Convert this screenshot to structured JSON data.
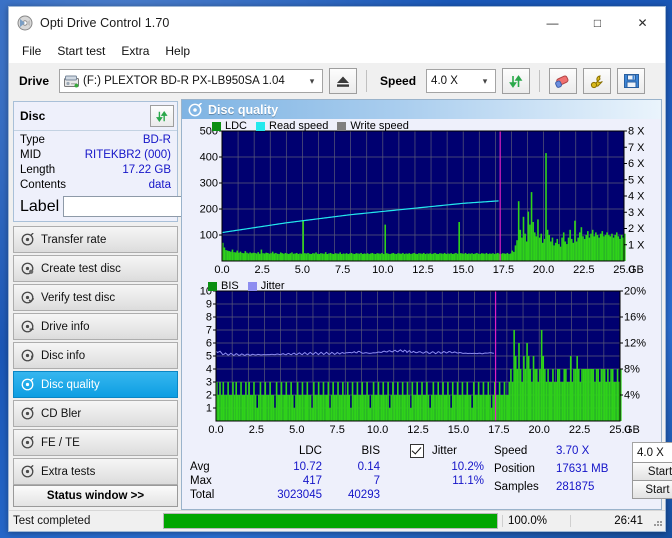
{
  "window": {
    "title": "Opti Drive Control 1.70",
    "icon": "disc-icon",
    "minimize": "—",
    "maximize": "□",
    "close": "✕"
  },
  "menu": [
    "File",
    "Start test",
    "Extra",
    "Help"
  ],
  "toolbar": {
    "drive_label": "Drive",
    "drive_value": "(F:)   PLEXTOR BD-R  PX-LB950SA 1.04",
    "eject_icon": "eject-icon",
    "speed_label": "Speed",
    "speed_value": "4.0 X",
    "refresh_icon": "refresh-icon",
    "erase_icon": "eraser-icon",
    "tools_icon": "wrench-icon",
    "save_icon": "floppy-save-icon"
  },
  "disc": {
    "header": "Disc",
    "refresh_icon": "refresh-icon",
    "rows": [
      {
        "key": "Type",
        "value": "BD-R"
      },
      {
        "key": "MID",
        "value": "RITEKBR2 (000)"
      },
      {
        "key": "Length",
        "value": "17.22 GB"
      },
      {
        "key": "Contents",
        "value": "data"
      }
    ],
    "label_key": "Label",
    "label_value": "",
    "label_placeholder": "",
    "disc_icon": "cd-icon"
  },
  "nav": [
    {
      "label": "Transfer rate",
      "icon": "disc-icon",
      "selected": false
    },
    {
      "label": "Create test disc",
      "icon": "disc-icon",
      "selected": false
    },
    {
      "label": "Verify test disc",
      "icon": "disc-icon",
      "selected": false
    },
    {
      "label": "Drive info",
      "icon": "disc-icon",
      "selected": false
    },
    {
      "label": "Disc info",
      "icon": "disc-icon",
      "selected": false
    },
    {
      "label": "Disc quality",
      "icon": "disc-icon",
      "selected": true
    },
    {
      "label": "CD Bler",
      "icon": "disc-icon",
      "selected": false
    },
    {
      "label": "FE / TE",
      "icon": "disc-icon",
      "selected": false
    },
    {
      "label": "Extra tests",
      "icon": "disc-icon",
      "selected": false
    }
  ],
  "status_window_button": "Status window >>",
  "pane": {
    "title": "Disc quality",
    "icon": "disc-quality-icon"
  },
  "stats": {
    "col_ldc": "LDC",
    "col_bis": "BIS",
    "row_avg": "Avg",
    "row_max": "Max",
    "row_total": "Total",
    "ldc_avg": "10.72",
    "ldc_max": "417",
    "ldc_total": "3023045",
    "bis_avg": "0.14",
    "bis_max": "7",
    "bis_total": "40293",
    "jitter_label": "Jitter",
    "jitter_checked": true,
    "jitter_avg": "10.2%",
    "jitter_max": "11.1%",
    "speed_label": "Speed",
    "speed_value": "3.70 X",
    "position_label": "Position",
    "position_value": "17631 MB",
    "samples_label": "Samples",
    "samples_value": "281875",
    "speed_select": "4.0 X",
    "start_full": "Start full",
    "start_part": "Start part"
  },
  "statusbar": {
    "text": "Test completed",
    "progress": 100,
    "percent": "100.0%",
    "time": "26:41"
  },
  "colors": {
    "plot_bg": "#000070",
    "ldc_green": "#2fd21a",
    "read_speed": "#23e9ed",
    "write_speed": "#7f7f7f",
    "jitter": "#8d8df0",
    "marker": "#e020c0",
    "grid": "#5a5a78",
    "value_blue": "#1414c8",
    "accent": "#0d9ee2",
    "progress_green": "#00a600"
  },
  "chart_data": [
    {
      "type": "line",
      "id": "ldc-chart",
      "title": "",
      "legend": [
        {
          "label": "LDC",
          "color": "#2fd21a"
        },
        {
          "label": "Read speed",
          "color": "#23e9ed"
        },
        {
          "label": "Write speed",
          "color": "#7f7f7f"
        }
      ],
      "legend_position": "top-left",
      "xlabel": "GB",
      "xlim": [
        0,
        25
      ],
      "xticks": [
        "0.0",
        "2.5",
        "5.0",
        "7.5",
        "10.0",
        "12.5",
        "15.0",
        "17.5",
        "20.0",
        "22.5",
        "25.0"
      ],
      "ylabel_left": "LDC",
      "ylim_left": [
        0,
        500
      ],
      "yticks_left": [
        "100",
        "200",
        "300",
        "400",
        "500"
      ],
      "ylabel_right": "Speed",
      "ylim_right": [
        0,
        8
      ],
      "yticks_right": [
        "1 X",
        "2 X",
        "3 X",
        "4 X",
        "5 X",
        "6 X",
        "7 X",
        "8 X"
      ],
      "grid": true,
      "marker_x": 17.3,
      "data_end_x": 17.2,
      "series": [
        {
          "name": "LDC",
          "type": "area",
          "color": "#2fd21a",
          "x_step": 0.1,
          "values": [
            70,
            52,
            42,
            40,
            38,
            36,
            44,
            34,
            33,
            40,
            32,
            36,
            31,
            30,
            38,
            32,
            29,
            33,
            30,
            32,
            31,
            29,
            34,
            28,
            44,
            30,
            29,
            32,
            31,
            28,
            30,
            36,
            29,
            31,
            28,
            27,
            33,
            30,
            28,
            31,
            29,
            27,
            30,
            33,
            28,
            29,
            31,
            27,
            29,
            28,
            155,
            30,
            29,
            31,
            28,
            27,
            30,
            29,
            33,
            28,
            27,
            30,
            29,
            28,
            34,
            27,
            29,
            31,
            28,
            27,
            30,
            29,
            28,
            33,
            27,
            29,
            28,
            30,
            27,
            29,
            31,
            28,
            27,
            30,
            29,
            28,
            31,
            27,
            29,
            28,
            30,
            27,
            29,
            31,
            28,
            27,
            30,
            29,
            28,
            31,
            27,
            140,
            30,
            28,
            27,
            29,
            31,
            28,
            27,
            30,
            29,
            28,
            31,
            27,
            29,
            28,
            30,
            27,
            29,
            31,
            28,
            27,
            30,
            29,
            28,
            31,
            27,
            29,
            28,
            30,
            27,
            29,
            31,
            28,
            27,
            30,
            29,
            28,
            31,
            27,
            29,
            28,
            30,
            27,
            29,
            31,
            28,
            150,
            30,
            29,
            28,
            31,
            27,
            29,
            28,
            30,
            27,
            29,
            31,
            28,
            27,
            30,
            29,
            28,
            31,
            27,
            29,
            28,
            30,
            27,
            29,
            31,
            28,
            27,
            30,
            29,
            28,
            31,
            27,
            29,
            40,
            35,
            60,
            80,
            230,
            120,
            90,
            170,
            105,
            75,
            190,
            140,
            265,
            150,
            110,
            95,
            160,
            90,
            105,
            70,
            85,
            415,
            120,
            100,
            75,
            90,
            60,
            70,
            85,
            65,
            55,
            90,
            110,
            75,
            65,
            90,
            120,
            85,
            70,
            155,
            75,
            90,
            110,
            130,
            95,
            85,
            100,
            115,
            90,
            105,
            120,
            95,
            110,
            100,
            90,
            105,
            115,
            95,
            100,
            110,
            100,
            95,
            105,
            90,
            100,
            110,
            95,
            85,
            100,
            90,
            105,
            95,
            100,
            85,
            90,
            95,
            75,
            60,
            45,
            40,
            38,
            42,
            36,
            40,
            35,
            38,
            42,
            36,
            40,
            35,
            38,
            42,
            36,
            40,
            35,
            38,
            42,
            150,
            40,
            35,
            38,
            42,
            36,
            40,
            35,
            38,
            42,
            36,
            40,
            35,
            38,
            42,
            155,
            40,
            35,
            38,
            42,
            36,
            40,
            35,
            38,
            42,
            36,
            40,
            35,
            38,
            42,
            36,
            40,
            35,
            38,
            42,
            36,
            40,
            35,
            38,
            42,
            36,
            40,
            35,
            38,
            42,
            36,
            40,
            35,
            38,
            42,
            36,
            40,
            35,
            38,
            42,
            36,
            40,
            35,
            38,
            42,
            36,
            40,
            30
          ]
        },
        {
          "name": "Read speed",
          "type": "line",
          "color": "#23e9ed",
          "axis": "right",
          "points": [
            [
              0.0,
              1.75
            ],
            [
              2.0,
              2.05
            ],
            [
              4.0,
              2.35
            ],
            [
              6.0,
              2.6
            ],
            [
              8.0,
              2.85
            ],
            [
              10.0,
              3.05
            ],
            [
              12.5,
              3.3
            ],
            [
              15.0,
              3.55
            ],
            [
              17.2,
              3.7
            ]
          ]
        }
      ]
    },
    {
      "type": "line",
      "id": "bis-chart",
      "title": "",
      "legend": [
        {
          "label": "BIS",
          "color": "#2fd21a"
        },
        {
          "label": "Jitter",
          "color": "#8d8df0"
        }
      ],
      "legend_position": "top-left",
      "xlabel": "GB",
      "xlim": [
        0,
        25
      ],
      "xticks": [
        "0.0",
        "2.5",
        "5.0",
        "7.5",
        "10.0",
        "12.5",
        "15.0",
        "17.5",
        "20.0",
        "22.5",
        "25.0"
      ],
      "ylabel_left": "BIS",
      "ylim_left": [
        0,
        10
      ],
      "yticks_left": [
        "1",
        "2",
        "3",
        "4",
        "5",
        "6",
        "7",
        "8",
        "9",
        "10"
      ],
      "ylabel_right": "Jitter",
      "ylim_right": [
        0,
        20
      ],
      "yticks_right": [
        "4%",
        "8%",
        "12%",
        "16%",
        "20%"
      ],
      "grid": true,
      "marker_x": 17.3,
      "data_end_x": 17.2,
      "series": [
        {
          "name": "BIS",
          "type": "area",
          "color": "#2fd21a",
          "x_step": 0.1,
          "values": [
            3,
            2,
            3,
            2,
            3,
            2,
            2,
            3,
            2,
            2,
            3,
            2,
            3,
            2,
            2,
            3,
            2,
            2,
            3,
            2,
            3,
            2,
            2,
            3,
            2,
            1,
            2,
            3,
            2,
            2,
            3,
            2,
            2,
            3,
            2,
            2,
            1,
            3,
            2,
            2,
            3,
            2,
            2,
            3,
            2,
            2,
            3,
            2,
            1,
            2,
            3,
            2,
            2,
            3,
            2,
            2,
            3,
            2,
            2,
            1,
            3,
            2,
            2,
            3,
            2,
            2,
            3,
            2,
            2,
            3,
            1,
            2,
            3,
            2,
            2,
            3,
            2,
            2,
            3,
            2,
            2,
            3,
            2,
            1,
            3,
            2,
            2,
            3,
            2,
            2,
            3,
            2,
            2,
            3,
            2,
            1,
            2,
            3,
            2,
            2,
            3,
            2,
            2,
            3,
            2,
            2,
            3,
            1,
            2,
            3,
            2,
            2,
            3,
            2,
            2,
            3,
            2,
            2,
            3,
            2,
            1,
            3,
            2,
            2,
            3,
            2,
            2,
            3,
            2,
            2,
            3,
            2,
            1,
            2,
            3,
            2,
            2,
            3,
            2,
            2,
            3,
            2,
            2,
            3,
            2,
            1,
            3,
            2,
            2,
            3,
            2,
            2,
            3,
            2,
            2,
            3,
            2,
            2,
            1,
            3,
            2,
            2,
            3,
            2,
            2,
            3,
            2,
            2,
            3,
            2,
            1,
            2,
            3,
            2,
            2,
            3,
            2,
            2,
            3,
            2,
            2,
            3,
            4,
            3,
            7,
            5,
            4,
            6,
            4,
            3,
            5,
            4,
            6,
            5,
            4,
            3,
            5,
            4,
            4,
            3,
            4,
            7,
            5,
            4,
            3,
            4,
            3,
            3,
            4,
            3,
            3,
            4,
            4,
            3,
            3,
            4,
            4,
            3,
            3,
            5,
            3,
            4,
            4,
            5,
            4,
            3,
            4,
            4,
            4,
            4,
            4,
            4,
            4,
            4,
            3,
            4,
            4,
            3,
            4,
            4,
            4,
            3,
            4,
            3,
            4,
            4,
            3,
            3,
            4,
            3,
            4,
            3,
            4,
            3,
            3,
            3,
            3,
            2,
            2,
            2,
            2,
            2,
            2,
            3,
            2,
            2,
            3,
            2,
            2,
            3,
            2,
            3,
            2,
            2,
            3,
            2,
            3,
            2,
            3,
            2,
            2,
            3,
            2,
            3,
            2,
            2,
            3,
            2,
            2,
            3,
            2,
            3,
            4,
            2,
            2,
            3,
            2,
            3,
            2,
            2,
            3,
            2,
            3,
            2,
            2,
            3,
            2,
            3,
            2,
            2,
            3,
            2,
            3,
            2,
            2,
            3,
            2,
            3,
            2,
            2,
            3,
            2,
            2,
            3,
            2,
            3,
            2,
            2,
            3,
            2,
            3,
            2,
            2,
            3,
            2,
            2,
            3,
            2,
            2,
            2
          ]
        },
        {
          "name": "Jitter",
          "type": "line",
          "color": "#8d8df0",
          "axis": "right",
          "points": [
            [
              0.0,
              10.8
            ],
            [
              0.5,
              10.3
            ],
            [
              1.5,
              10.2
            ],
            [
              3.0,
              10.2
            ],
            [
              4.5,
              10.3
            ],
            [
              6.0,
              10.4
            ],
            [
              7.5,
              10.4
            ],
            [
              8.8,
              10.6
            ],
            [
              9.5,
              10.4
            ],
            [
              10.5,
              10.7
            ],
            [
              11.5,
              10.8
            ],
            [
              12.3,
              10.6
            ],
            [
              13.5,
              10.5
            ],
            [
              14.5,
              10.6
            ],
            [
              15.5,
              10.4
            ],
            [
              16.5,
              10.4
            ],
            [
              17.2,
              10.5
            ]
          ]
        }
      ]
    }
  ]
}
